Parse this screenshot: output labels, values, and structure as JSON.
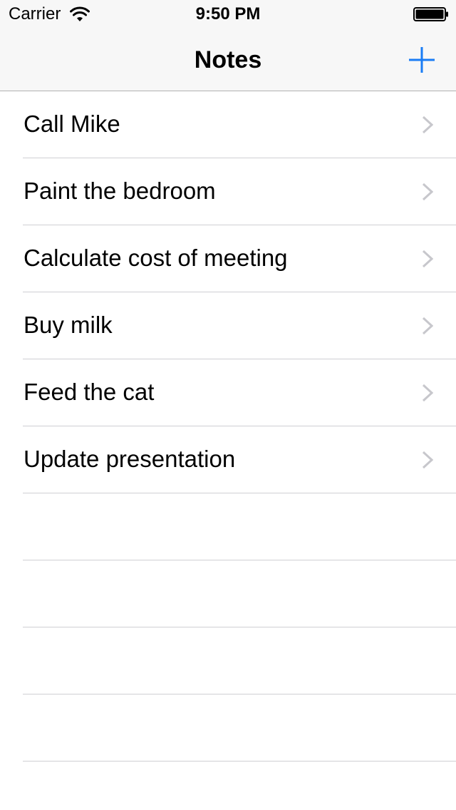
{
  "status_bar": {
    "carrier": "Carrier",
    "time": "9:50 PM",
    "wifi_icon": "wifi-icon",
    "battery_icon": "battery-full-icon"
  },
  "nav": {
    "title": "Notes",
    "add_icon": "plus-icon",
    "accent_color": "#1a7cf5"
  },
  "notes": [
    {
      "label": "Call Mike"
    },
    {
      "label": "Paint the bedroom"
    },
    {
      "label": "Calculate cost of meeting"
    },
    {
      "label": "Buy milk"
    },
    {
      "label": "Feed the cat"
    },
    {
      "label": "Update presentation"
    }
  ],
  "row_accessory_icon": "chevron-right-icon"
}
